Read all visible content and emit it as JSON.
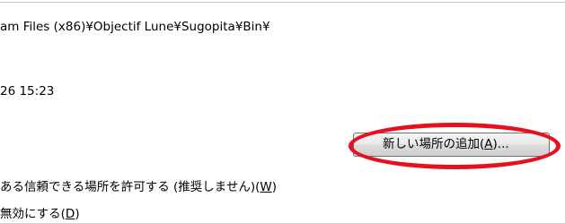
{
  "app_location": {
    "path_text": "am Files (x86)¥Objectif Lune¥Sugopita¥Bin¥"
  },
  "modified": {
    "date_text": "26 15:23"
  },
  "add_location_button": {
    "label_prefix": "新しい場所の追加(",
    "mnemonic": "A",
    "label_suffix": ")..."
  },
  "allow_network_checkbox": {
    "label_prefix": "ある信頼できる場所を許可する (推奨しません)(",
    "mnemonic": "W",
    "label_suffix": ")"
  },
  "disable_all_checkbox": {
    "label_prefix": "無効にする(",
    "mnemonic": "D",
    "label_suffix": ")"
  },
  "annotation": {
    "color": "#e8101c"
  }
}
